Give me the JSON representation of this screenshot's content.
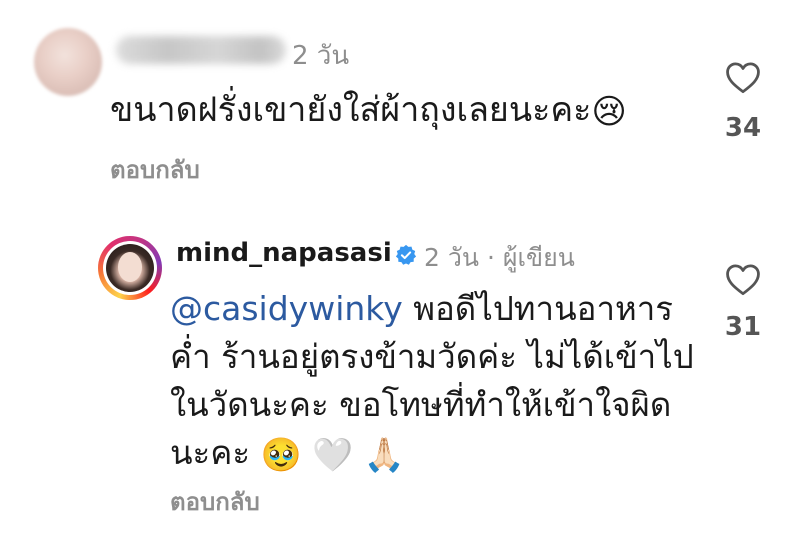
{
  "comments": [
    {
      "time": "2 วัน",
      "text": "ขนาดฝรั่งเขายังใส่ผ้าถุงเลยนะคะ",
      "text_emoji": "😢",
      "reply_label": "ตอบกลับ",
      "likes": "34"
    },
    {
      "username": "mind_napasasi",
      "time": "2 วัน",
      "separator": "·",
      "author_label": "ผู้เขียน",
      "mention": "@casidywinky",
      "line1_rest": " พอดีไปทานอาหาร",
      "line2": "ค่ำ ร้านอยู่ตรงข้ามวัดค่ะ ไม่ได้เข้าไป",
      "line3": "ในวัดนะคะ ขอโทษที่ทำให้เข้าใจผิด",
      "line4": "นะคะ",
      "emojis": [
        "🥹",
        "🤍",
        "🙏🏻"
      ],
      "reply_label": "ตอบกลับ",
      "likes": "31"
    }
  ],
  "icons": {
    "like": "heart-outline-icon",
    "verified": "verified-badge-icon"
  },
  "colors": {
    "muted": "#8e8e8e",
    "mention": "#2c5aa0",
    "verified": "#3897f0"
  }
}
